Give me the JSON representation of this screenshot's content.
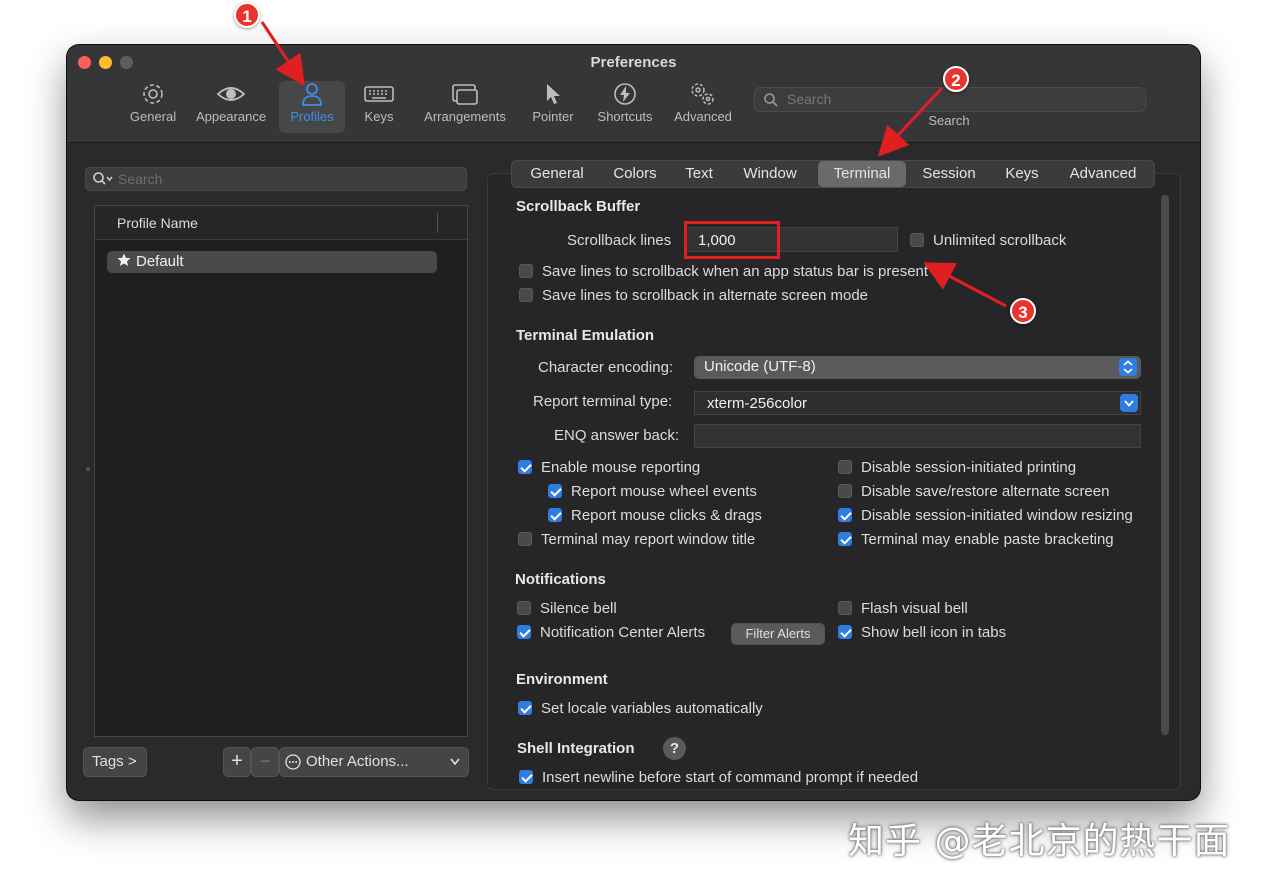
{
  "window": {
    "title": "Preferences"
  },
  "toolbar": {
    "items": [
      {
        "label": "General",
        "icon": "gear-icon"
      },
      {
        "label": "Appearance",
        "icon": "eye-icon"
      },
      {
        "label": "Profiles",
        "icon": "person-icon"
      },
      {
        "label": "Keys",
        "icon": "keyboard-icon"
      },
      {
        "label": "Arrangements",
        "icon": "windows-icon"
      },
      {
        "label": "Pointer",
        "icon": "pointer-icon"
      },
      {
        "label": "Shortcuts",
        "icon": "lightning-icon"
      },
      {
        "label": "Advanced",
        "icon": "gears-icon"
      }
    ],
    "search_placeholder": "Search",
    "search_label": "Search"
  },
  "sidebar": {
    "search_placeholder": "Search",
    "column_header": "Profile Name",
    "profiles": [
      {
        "name": "Default",
        "icon": "star-icon"
      }
    ],
    "tags_button": "Tags >",
    "add_label": "+",
    "remove_label": "−",
    "other_actions": "Other Actions..."
  },
  "tabs": [
    "General",
    "Colors",
    "Text",
    "Window",
    "Terminal",
    "Session",
    "Keys",
    "Advanced"
  ],
  "selected_tab": "Terminal",
  "scrollback": {
    "title": "Scrollback Buffer",
    "lines_label": "Scrollback lines",
    "lines_value": "1,000",
    "unlimited_label": "Unlimited scrollback",
    "save_status_bar": "Save lines to scrollback when an app status bar is present",
    "save_alternate": "Save lines to scrollback in alternate screen mode"
  },
  "emulation": {
    "title": "Terminal Emulation",
    "encoding_label": "Character encoding:",
    "encoding_value": "Unicode (UTF-8)",
    "type_label": "Report terminal type:",
    "type_value": "xterm-256color",
    "enq_label": "ENQ answer back:",
    "left_checks": [
      {
        "label": "Enable mouse reporting",
        "checked": true
      },
      {
        "label": "Report mouse wheel events",
        "checked": true
      },
      {
        "label": "Report mouse clicks & drags",
        "checked": true
      },
      {
        "label": "Terminal may report window title",
        "checked": false
      }
    ],
    "right_checks": [
      {
        "label": "Disable session-initiated printing",
        "checked": false
      },
      {
        "label": "Disable save/restore alternate screen",
        "checked": false
      },
      {
        "label": "Disable session-initiated window resizing",
        "checked": true
      },
      {
        "label": "Terminal may enable paste bracketing",
        "checked": true
      }
    ]
  },
  "notifications": {
    "title": "Notifications",
    "silence_bell": "Silence bell",
    "nc_alerts": "Notification Center Alerts",
    "filter_alerts": "Filter Alerts",
    "flash_bell": "Flash visual bell",
    "show_bell_icon": "Show bell icon in tabs"
  },
  "environment": {
    "title": "Environment",
    "set_locale": "Set locale variables automatically"
  },
  "shell": {
    "title": "Shell Integration",
    "help": "?",
    "insert_newline": "Insert newline before start of command prompt if needed"
  },
  "annotations": [
    "1",
    "2",
    "3"
  ],
  "watermark": "知乎 @老北京的热干面",
  "colors": {
    "accent": "#2f7de1",
    "annotation": "#e8342f",
    "selected_toolbar": "#3d8fe6"
  }
}
